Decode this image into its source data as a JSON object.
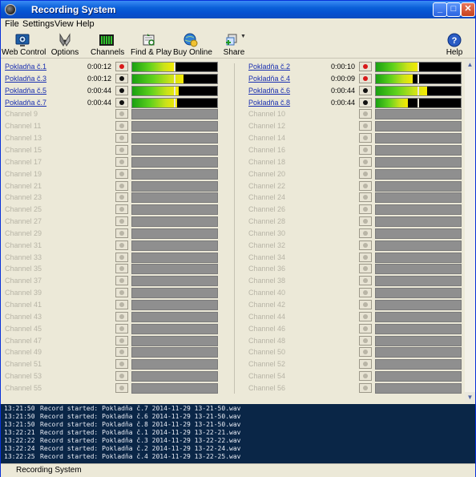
{
  "window": {
    "title": "Recording System",
    "controls": [
      "_",
      "□",
      "✕"
    ]
  },
  "menu": [
    "File",
    "Settings",
    "View",
    "Help"
  ],
  "toolbar": [
    {
      "label": "Web Control",
      "icon": "web-control-icon"
    },
    {
      "label": "Options",
      "icon": "options-icon"
    },
    {
      "label": "Channels",
      "icon": "channels-icon"
    },
    {
      "label": "Find & Play",
      "icon": "find-play-icon"
    },
    {
      "label": "Buy Online",
      "icon": "buy-online-icon"
    },
    {
      "label": "Share",
      "icon": "share-icon"
    },
    {
      "label": "Help",
      "icon": "help-icon"
    }
  ],
  "channels_left": [
    {
      "name": "Pokladňa č.1",
      "time": "0:00:12",
      "active": true,
      "recording": true,
      "level": 0.5
    },
    {
      "name": "Pokladňa č.3",
      "time": "0:00:12",
      "active": true,
      "recording": false,
      "level": 0.6
    },
    {
      "name": "Pokladňa č.5",
      "time": "0:00:44",
      "active": true,
      "recording": false,
      "level": 0.55
    },
    {
      "name": "Pokladňa č.7",
      "time": "0:00:44",
      "active": true,
      "recording": false,
      "level": 0.53
    },
    {
      "name": "Channel 9",
      "active": false
    },
    {
      "name": "Channel 11",
      "active": false
    },
    {
      "name": "Channel 13",
      "active": false
    },
    {
      "name": "Channel 15",
      "active": false
    },
    {
      "name": "Channel 17",
      "active": false
    },
    {
      "name": "Channel 19",
      "active": false
    },
    {
      "name": "Channel 21",
      "active": false
    },
    {
      "name": "Channel 23",
      "active": false
    },
    {
      "name": "Channel 25",
      "active": false
    },
    {
      "name": "Channel 27",
      "active": false
    },
    {
      "name": "Channel 29",
      "active": false
    },
    {
      "name": "Channel 31",
      "active": false
    },
    {
      "name": "Channel 33",
      "active": false
    },
    {
      "name": "Channel 35",
      "active": false
    },
    {
      "name": "Channel 37",
      "active": false
    },
    {
      "name": "Channel 39",
      "active": false
    },
    {
      "name": "Channel 41",
      "active": false
    },
    {
      "name": "Channel 43",
      "active": false
    },
    {
      "name": "Channel 45",
      "active": false
    },
    {
      "name": "Channel 47",
      "active": false
    },
    {
      "name": "Channel 49",
      "active": false
    },
    {
      "name": "Channel 51",
      "active": false
    },
    {
      "name": "Channel 53",
      "active": false
    },
    {
      "name": "Channel 55",
      "active": false
    }
  ],
  "channels_right": [
    {
      "name": "Pokladňa č.2",
      "time": "0:00:10",
      "active": true,
      "recording": true,
      "level": 0.5
    },
    {
      "name": "Pokladňa č.4",
      "time": "0:00:09",
      "active": true,
      "recording": true,
      "level": 0.43
    },
    {
      "name": "Pokladňa č.6",
      "time": "0:00:44",
      "active": true,
      "recording": false,
      "level": 0.6
    },
    {
      "name": "Pokladňa č.8",
      "time": "0:00:44",
      "active": true,
      "recording": false,
      "level": 0.38
    },
    {
      "name": "Channel 10",
      "active": false
    },
    {
      "name": "Channel 12",
      "active": false
    },
    {
      "name": "Channel 14",
      "active": false
    },
    {
      "name": "Channel 16",
      "active": false
    },
    {
      "name": "Channel 18",
      "active": false
    },
    {
      "name": "Channel 20",
      "active": false
    },
    {
      "name": "Channel 22",
      "active": false
    },
    {
      "name": "Channel 24",
      "active": false
    },
    {
      "name": "Channel 26",
      "active": false
    },
    {
      "name": "Channel 28",
      "active": false
    },
    {
      "name": "Channel 30",
      "active": false
    },
    {
      "name": "Channel 32",
      "active": false
    },
    {
      "name": "Channel 34",
      "active": false
    },
    {
      "name": "Channel 36",
      "active": false
    },
    {
      "name": "Channel 38",
      "active": false
    },
    {
      "name": "Channel 40",
      "active": false
    },
    {
      "name": "Channel 42",
      "active": false
    },
    {
      "name": "Channel 44",
      "active": false
    },
    {
      "name": "Channel 46",
      "active": false
    },
    {
      "name": "Channel 48",
      "active": false
    },
    {
      "name": "Channel 50",
      "active": false
    },
    {
      "name": "Channel 52",
      "active": false
    },
    {
      "name": "Channel 54",
      "active": false
    },
    {
      "name": "Channel 56",
      "active": false
    }
  ],
  "log": [
    {
      "time": "13:21:50",
      "msg": "Record started: Pokladňa č.7 2014-11-29 13-21-50.wav"
    },
    {
      "time": "13:21:50",
      "msg": "Record started: Pokladňa č.6 2014-11-29 13-21-50.wav"
    },
    {
      "time": "13:21:50",
      "msg": "Record started: Pokladňa č.8 2014-11-29 13-21-50.wav"
    },
    {
      "time": "13:22:21",
      "msg": "Record started: Pokladňa č.1 2014-11-29 13-22-21.wav"
    },
    {
      "time": "13:22:22",
      "msg": "Record started: Pokladňa č.3 2014-11-29 13-22-22.wav"
    },
    {
      "time": "13:22:24",
      "msg": "Record started: Pokladňa č.2 2014-11-29 13-22-24.wav"
    },
    {
      "time": "13:22:25",
      "msg": "Record started: Pokladňa č.4 2014-11-29 13-22-25.wav"
    }
  ],
  "status": {
    "text": "Recording System"
  },
  "colors": {
    "rec_active": "#d81818",
    "rec_idle": "#111111",
    "rec_off": "#b9b5a6",
    "link": "#1a2fb0",
    "log_bg": "#0a2647"
  }
}
